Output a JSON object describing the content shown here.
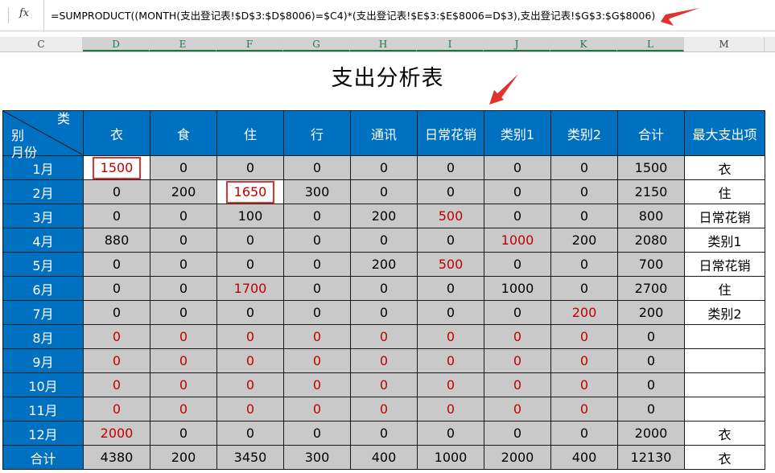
{
  "formula_bar": {
    "fx_label": "fx",
    "formula": "=SUMPRODUCT((MONTH(支出登记表!$D$3:$D$8006)=$C4)*(支出登记表!$E$3:$E$8006=D$3),支出登记表!$G$3:$G$8006)"
  },
  "columns": [
    "C",
    "D",
    "E",
    "F",
    "G",
    "H",
    "I",
    "J",
    "K",
    "L",
    "M"
  ],
  "title": "支出分析表",
  "table": {
    "corner": {
      "top": "类",
      "mid": "别",
      "bottom": "月份"
    },
    "headers": [
      "衣",
      "食",
      "住",
      "行",
      "通讯",
      "日常花销",
      "类别1",
      "类别2",
      "合计",
      "最大支出项"
    ],
    "rows": [
      {
        "month": "1月",
        "values": [
          "1500",
          "0",
          "0",
          "0",
          "0",
          "0",
          "0",
          "0",
          "1500"
        ],
        "max": "衣"
      },
      {
        "month": "2月",
        "values": [
          "0",
          "200",
          "1650",
          "300",
          "0",
          "0",
          "0",
          "0",
          "2150"
        ],
        "max": "住"
      },
      {
        "month": "3月",
        "values": [
          "0",
          "0",
          "100",
          "0",
          "200",
          "500",
          "0",
          "0",
          "800"
        ],
        "max": "日常花销"
      },
      {
        "month": "4月",
        "values": [
          "880",
          "0",
          "0",
          "0",
          "0",
          "0",
          "1000",
          "200",
          "2080"
        ],
        "max": "类别1"
      },
      {
        "month": "5月",
        "values": [
          "0",
          "0",
          "0",
          "0",
          "200",
          "500",
          "0",
          "0",
          "700"
        ],
        "max": "日常花销"
      },
      {
        "month": "6月",
        "values": [
          "0",
          "0",
          "1700",
          "0",
          "0",
          "0",
          "1000",
          "0",
          "2700"
        ],
        "max": "住"
      },
      {
        "month": "7月",
        "values": [
          "0",
          "0",
          "0",
          "0",
          "0",
          "0",
          "0",
          "200",
          "200"
        ],
        "max": "类别2"
      },
      {
        "month": "8月",
        "values": [
          "0",
          "0",
          "0",
          "0",
          "0",
          "0",
          "0",
          "0",
          "0"
        ],
        "max": ""
      },
      {
        "month": "9月",
        "values": [
          "0",
          "0",
          "0",
          "0",
          "0",
          "0",
          "0",
          "0",
          "0"
        ],
        "max": ""
      },
      {
        "month": "10月",
        "values": [
          "0",
          "0",
          "0",
          "0",
          "0",
          "0",
          "0",
          "0",
          "0"
        ],
        "max": ""
      },
      {
        "month": "11月",
        "values": [
          "0",
          "0",
          "0",
          "0",
          "0",
          "0",
          "0",
          "0",
          "0"
        ],
        "max": ""
      },
      {
        "month": "12月",
        "values": [
          "2000",
          "0",
          "0",
          "0",
          "0",
          "0",
          "0",
          "0",
          "2000"
        ],
        "max": "衣"
      },
      {
        "month": "合计",
        "values": [
          "4380",
          "200",
          "3450",
          "300",
          "400",
          "1000",
          "2000",
          "400",
          "12130"
        ],
        "max": "衣"
      }
    ]
  },
  "colors": {
    "header_blue": "#0070c0",
    "cell_gray": "#c9c9c9",
    "red_text": "#c00000",
    "annotation_red": "#e0322f"
  }
}
